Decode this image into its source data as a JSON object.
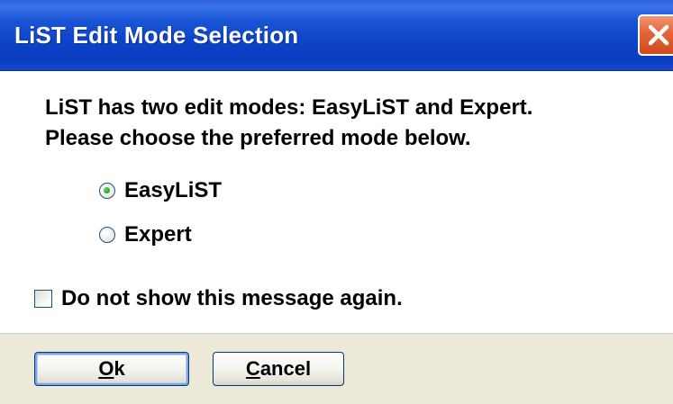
{
  "window": {
    "title": "LiST Edit Mode Selection",
    "close_icon": "close-icon"
  },
  "message": {
    "line1": "LiST has two edit modes: EasyLiST and Expert.",
    "line2": "Please choose the preferred mode below."
  },
  "modes": {
    "selected": "EasyLiST",
    "options": [
      {
        "label": "EasyLiST",
        "checked": true
      },
      {
        "label": "Expert",
        "checked": false
      }
    ]
  },
  "dont_show": {
    "label": "Do not show this message again.",
    "checked": false
  },
  "buttons": {
    "ok": {
      "accel": "O",
      "rest": "k"
    },
    "cancel": {
      "accel": "C",
      "rest": "ancel"
    }
  },
  "colors": {
    "titlebar": "#0c43c8",
    "close_button": "#e3643a",
    "button_bar": "#ece9d8",
    "radio_dot": "#21a121"
  }
}
